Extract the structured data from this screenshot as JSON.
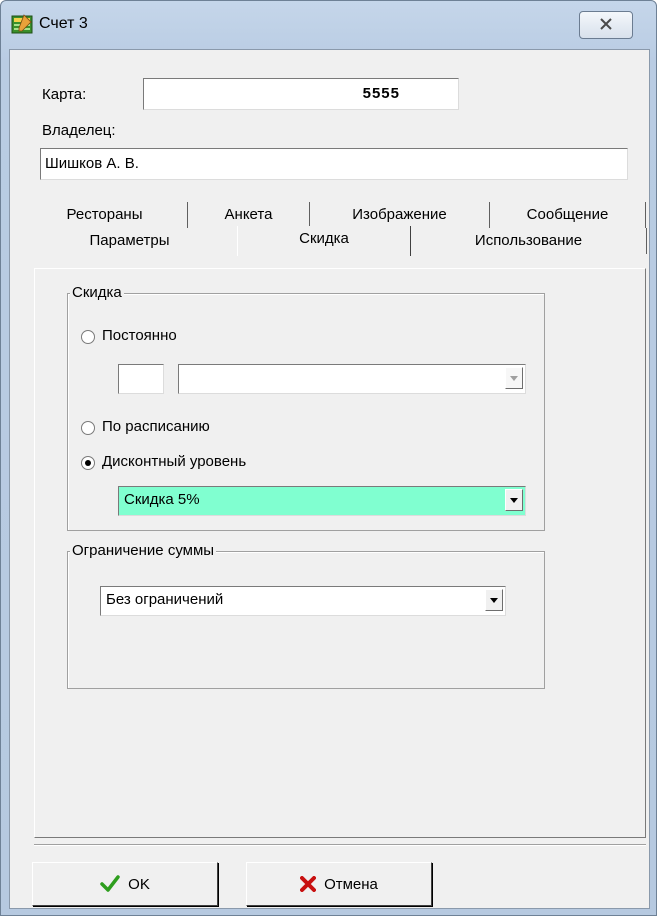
{
  "window": {
    "title": "Счет 3",
    "close_icon": "close-x-icon"
  },
  "card": {
    "label": "Карта:",
    "value": "5555"
  },
  "owner": {
    "label": "Владелец:",
    "value": "Шишков А. В."
  },
  "tabs": {
    "row1": [
      "Рестораны",
      "Анкета",
      "Изображение",
      "Сообщение"
    ],
    "row2": [
      "Параметры",
      "Скидка",
      "Использование"
    ],
    "active": "Скидка"
  },
  "discount": {
    "group_label": "Скидка",
    "permanent_label": "Постоянно",
    "permanent_value": "",
    "permanent_select": "",
    "schedule_label": "По расписанию",
    "level_label": "Дисконтный уровень",
    "level_value": "Скидка 5%",
    "selected_option": "Дисконтный уровень",
    "highlight_color": "#80ffd0"
  },
  "limit": {
    "group_label": "Ограничение суммы",
    "value": "Без ограничений"
  },
  "buttons": {
    "ok_label": "OK",
    "ok_icon": "checkmark-icon",
    "ok_color": "#2e9e1e",
    "cancel_label": "Отмена",
    "cancel_icon": "cross-icon",
    "cancel_color": "#c81010"
  }
}
